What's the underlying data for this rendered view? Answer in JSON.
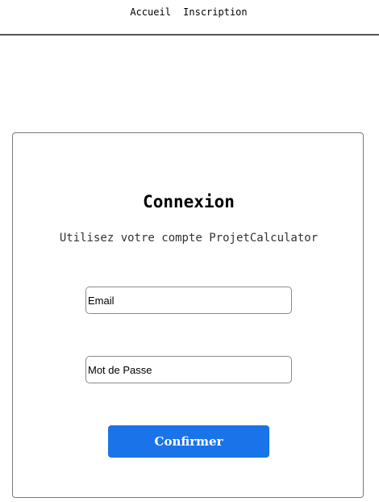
{
  "nav": {
    "links": [
      "Accueil",
      "Inscription"
    ]
  },
  "login": {
    "title": "Connexion",
    "subtitle": "Utilisez votre compte ProjetCalculator",
    "email_placeholder": "Email",
    "password_placeholder": "Mot de Passe",
    "submit_label": "Confirmer"
  },
  "colors": {
    "accent": "#1a73e8",
    "nav_border": "#555555",
    "card_border": "#7a7a7a"
  }
}
